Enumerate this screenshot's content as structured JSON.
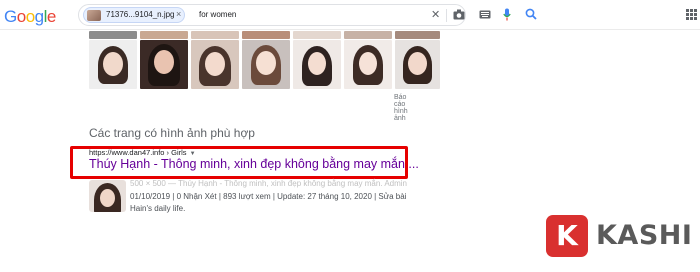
{
  "header": {
    "logo_letters": [
      {
        "char": "G",
        "color": "#4285f4"
      },
      {
        "char": "o",
        "color": "#ea4335"
      },
      {
        "char": "o",
        "color": "#fbbc05"
      },
      {
        "char": "g",
        "color": "#4285f4"
      },
      {
        "char": "l",
        "color": "#34a853"
      },
      {
        "char": "e",
        "color": "#ea4335"
      }
    ],
    "image_chip_label": "71376...9104_n.jpg",
    "image_chip_close": "×",
    "query": "for women",
    "clear_glyph": "✕",
    "camera_glyph": "📷",
    "keyboard_glyph": "⌨",
    "mic_glyph": "🎤",
    "search_glyph": "🔍"
  },
  "images": {
    "report_label": "Báo cáo hình ảnh"
  },
  "results": {
    "section_title": "Các trang có hình ảnh phù hợp",
    "breadcrumb_url": "https://www.dan47.info",
    "breadcrumb_path": " › Girls",
    "breadcrumb_caret": "▼",
    "title": "Thúy Hạnh - Thông minh, xinh đẹp không bằng may mắn ...",
    "snippet_line1": "500 × 500 — Thúy Hạnh - Thông minh, xinh đẹp không bằng may mắn. Admin",
    "snippet_line2": "01/10/2019 | 0 Nhận Xét | 893 lượt xem | Update: 27 tháng 10, 2020 | Sửa bài",
    "snippet_line3": "Hain's daily life."
  },
  "watermark": {
    "icon_letter": "K",
    "brand_text": "KASHI",
    "brand_color": "#d9302f"
  }
}
